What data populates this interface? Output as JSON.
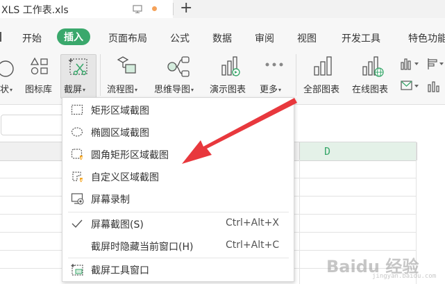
{
  "tab": {
    "title": "XLS 工作表.xls",
    "new_tab": "+"
  },
  "menu": [
    "开始",
    "插入",
    "页面布局",
    "公式",
    "数据",
    "审阅",
    "视图",
    "开发工具",
    "特色功能"
  ],
  "ribbon": {
    "shapes_partial": "状",
    "icon_library": "图标库",
    "screenshot": "截屏",
    "flowchart": "流程图",
    "mindmap": "思维导图",
    "demo_chart": "演示图表",
    "more": "更多",
    "all_charts": "全部图表",
    "online_charts": "在线图表"
  },
  "sheet": {
    "column_d": "D"
  },
  "dropdown": {
    "items": [
      {
        "label": "矩形区域截图"
      },
      {
        "label": "椭圆区域截图"
      },
      {
        "label": "圆角矩形区域截图"
      },
      {
        "label": "自定义区域截图"
      },
      {
        "label": "屏幕录制"
      }
    ],
    "screen_capture": {
      "label": "屏幕截图(S)",
      "shortcut": "Ctrl+Alt+X"
    },
    "hide_window": {
      "label": "截屏时隐藏当前窗口(H)",
      "shortcut": "Ctrl+Alt+C"
    },
    "tool_window": {
      "label": "截屏工具窗口"
    }
  },
  "watermark": {
    "main": "Baidu 经验",
    "sub": "jingyan.baidu.com"
  },
  "colors": {
    "accent": "#3aa86c",
    "arrow": "#e8383d",
    "badge": "#f5a623"
  }
}
